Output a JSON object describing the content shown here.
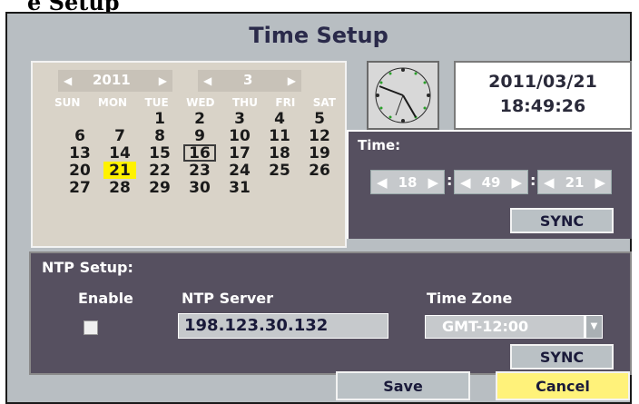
{
  "header_cut": "e Setup",
  "dialog": {
    "title": "Time Setup"
  },
  "calendar": {
    "year": "2011",
    "month": "3",
    "weekdays": [
      "SUN",
      "MON",
      "TUE",
      "WED",
      "THU",
      "FRI",
      "SAT"
    ],
    "weeks": [
      [
        "",
        "",
        "1",
        "2",
        "3",
        "4",
        "5"
      ],
      [
        "6",
        "7",
        "8",
        "9",
        "10",
        "11",
        "12"
      ],
      [
        "13",
        "14",
        "15",
        "16",
        "17",
        "18",
        "19"
      ],
      [
        "20",
        "21",
        "22",
        "23",
        "24",
        "25",
        "26"
      ],
      [
        "27",
        "28",
        "29",
        "30",
        "31",
        "",
        ""
      ]
    ],
    "today": "21",
    "selected": "16"
  },
  "datetime": {
    "date": "2011/03/21",
    "time": "18:49:26"
  },
  "time_panel": {
    "label": "Time:",
    "hour": "18",
    "minute": "49",
    "second": "21",
    "sync_label": "SYNC"
  },
  "ntp": {
    "label": "NTP Setup:",
    "enable_label": "Enable",
    "server_label": "NTP Server",
    "server_value": "198.123.30.132",
    "timezone_label": "Time Zone",
    "timezone_value": "GMT-12:00",
    "sync_label": "SYNC"
  },
  "buttons": {
    "save": "Save",
    "cancel": "Cancel"
  }
}
